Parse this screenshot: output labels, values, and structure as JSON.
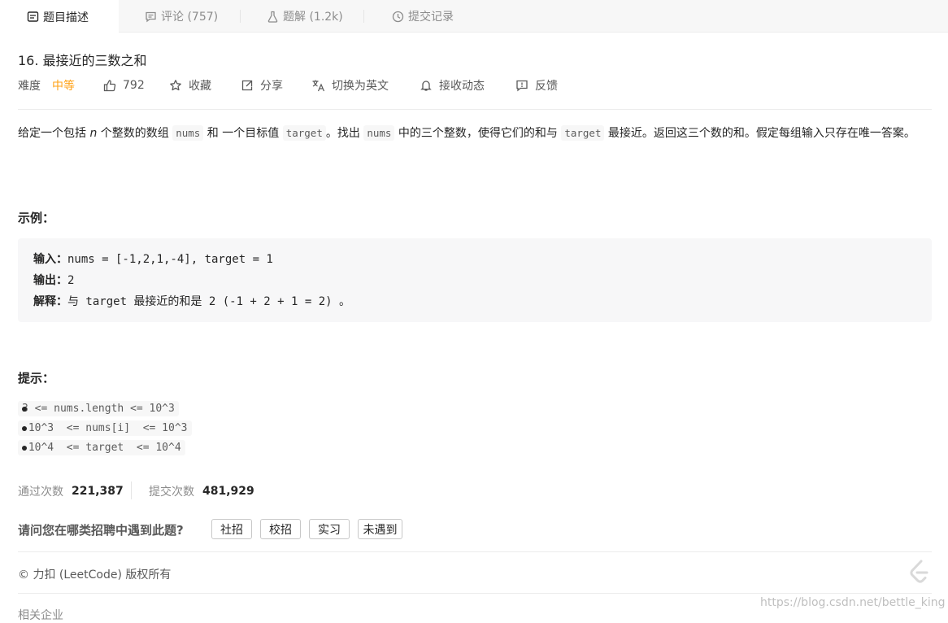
{
  "tabs": [
    {
      "label": "题目描述",
      "icon": "description-icon"
    },
    {
      "label": "评论 (757)",
      "icon": "comment-icon"
    },
    {
      "label": "题解 (1.2k)",
      "icon": "flask-icon"
    },
    {
      "label": "提交记录",
      "icon": "clock-icon"
    }
  ],
  "problem": {
    "title": "16. 最接近的三数之和",
    "difficulty_label": "难度",
    "difficulty": "中等",
    "likes": "792",
    "actions": {
      "favorite": "收藏",
      "share": "分享",
      "switch_lang": "切换为英文",
      "notify": "接收动态",
      "feedback": "反馈"
    }
  },
  "description": {
    "p1": "给定一个包括 ",
    "n": "n",
    "p2": " 个整数的数组 ",
    "c1": "nums",
    "p3": " 和 一个目标值 ",
    "c2": "target",
    "p4": "。找出 ",
    "c3": "nums",
    "p5": " 中的三个整数，使得它们的和与 ",
    "c4": "target",
    "p6": " 最接近。返回这三个数的和。假定每组输入只存在唯一答案。"
  },
  "example": {
    "heading": "示例：",
    "input_label": "输入：",
    "input": "nums = [-1,2,1,-4], target = 1",
    "output_label": "输出：",
    "output": "2",
    "explain_label": "解释：",
    "explain": "与 target 最接近的和是 2 (-1 + 2 + 1 = 2) 。"
  },
  "hints": {
    "heading": "提示：",
    "items": [
      "3 <= nums.length <= 10^3",
      "-10^3  <= nums[i]  <= 10^3",
      "-10^4  <= target  <= 10^4"
    ]
  },
  "stats": {
    "accepted_label": "通过次数",
    "accepted": "221,387",
    "submitted_label": "提交次数",
    "submitted": "481,929"
  },
  "survey": {
    "question": "请问您在哪类招聘中遇到此题?",
    "options": [
      "社招",
      "校招",
      "实习",
      "未遇到"
    ]
  },
  "footer": {
    "copyright": "© 力扣 (LeetCode) 版权所有",
    "companies": "相关企业",
    "watermark": "https://blog.csdn.net/bettle_king"
  },
  "colors": {
    "difficulty_medium": "#ffa116",
    "text": "#262626",
    "muted": "#8c8c8c"
  }
}
